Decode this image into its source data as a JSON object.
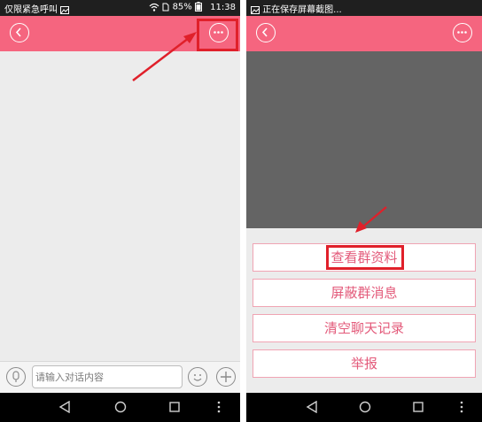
{
  "left_screen": {
    "status": {
      "carrier": "仅限紧急呼叫",
      "battery": "85%",
      "time": "11:38"
    },
    "input": {
      "placeholder": "请输入对话内容"
    }
  },
  "right_screen": {
    "status": {
      "notification": "正在保存屏幕截图..."
    },
    "menu": [
      {
        "label": "查看群资料"
      },
      {
        "label": "屏蔽群消息"
      },
      {
        "label": "清空聊天记录"
      },
      {
        "label": "举报"
      }
    ]
  },
  "colors": {
    "toolbar": "#f5657f",
    "highlight": "#e0202a",
    "menu_text": "#e35a7a",
    "menu_border": "#f0a4b3",
    "dark_overlay": "#646464"
  }
}
